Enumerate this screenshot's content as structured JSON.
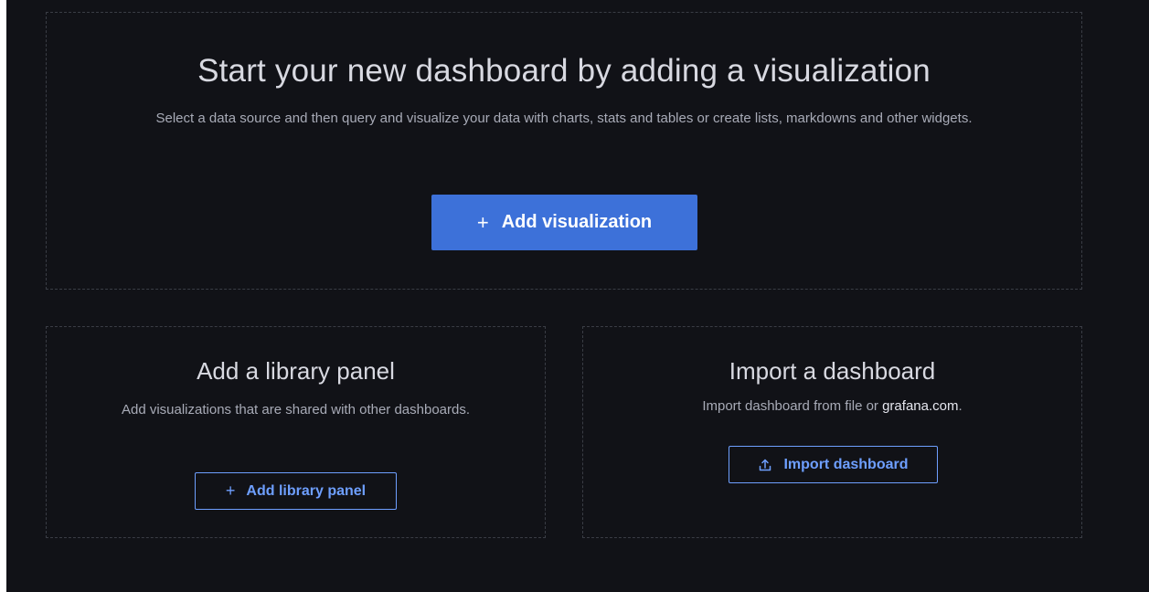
{
  "hero": {
    "title": "Start your new dashboard by adding a visualization",
    "description": "Select a data source and then query and visualize your data with charts, stats and tables or create lists, markdowns and other widgets.",
    "button_label": "Add visualization",
    "button_icon": "plus-icon"
  },
  "library_panel": {
    "title": "Add a library panel",
    "description": "Add visualizations that are shared with other dashboards.",
    "button_label": "Add library panel",
    "button_icon": "plus-icon"
  },
  "import_dashboard": {
    "title": "Import a dashboard",
    "description_prefix": "Import dashboard from file or ",
    "description_link": "grafana.com",
    "description_suffix": ".",
    "button_label": "Import dashboard",
    "button_icon": "upload-icon"
  },
  "colors": {
    "background": "#111217",
    "primary_button": "#3d71d9",
    "outline_button": "#6e9fff",
    "dashed_border": "#3a3d45"
  }
}
